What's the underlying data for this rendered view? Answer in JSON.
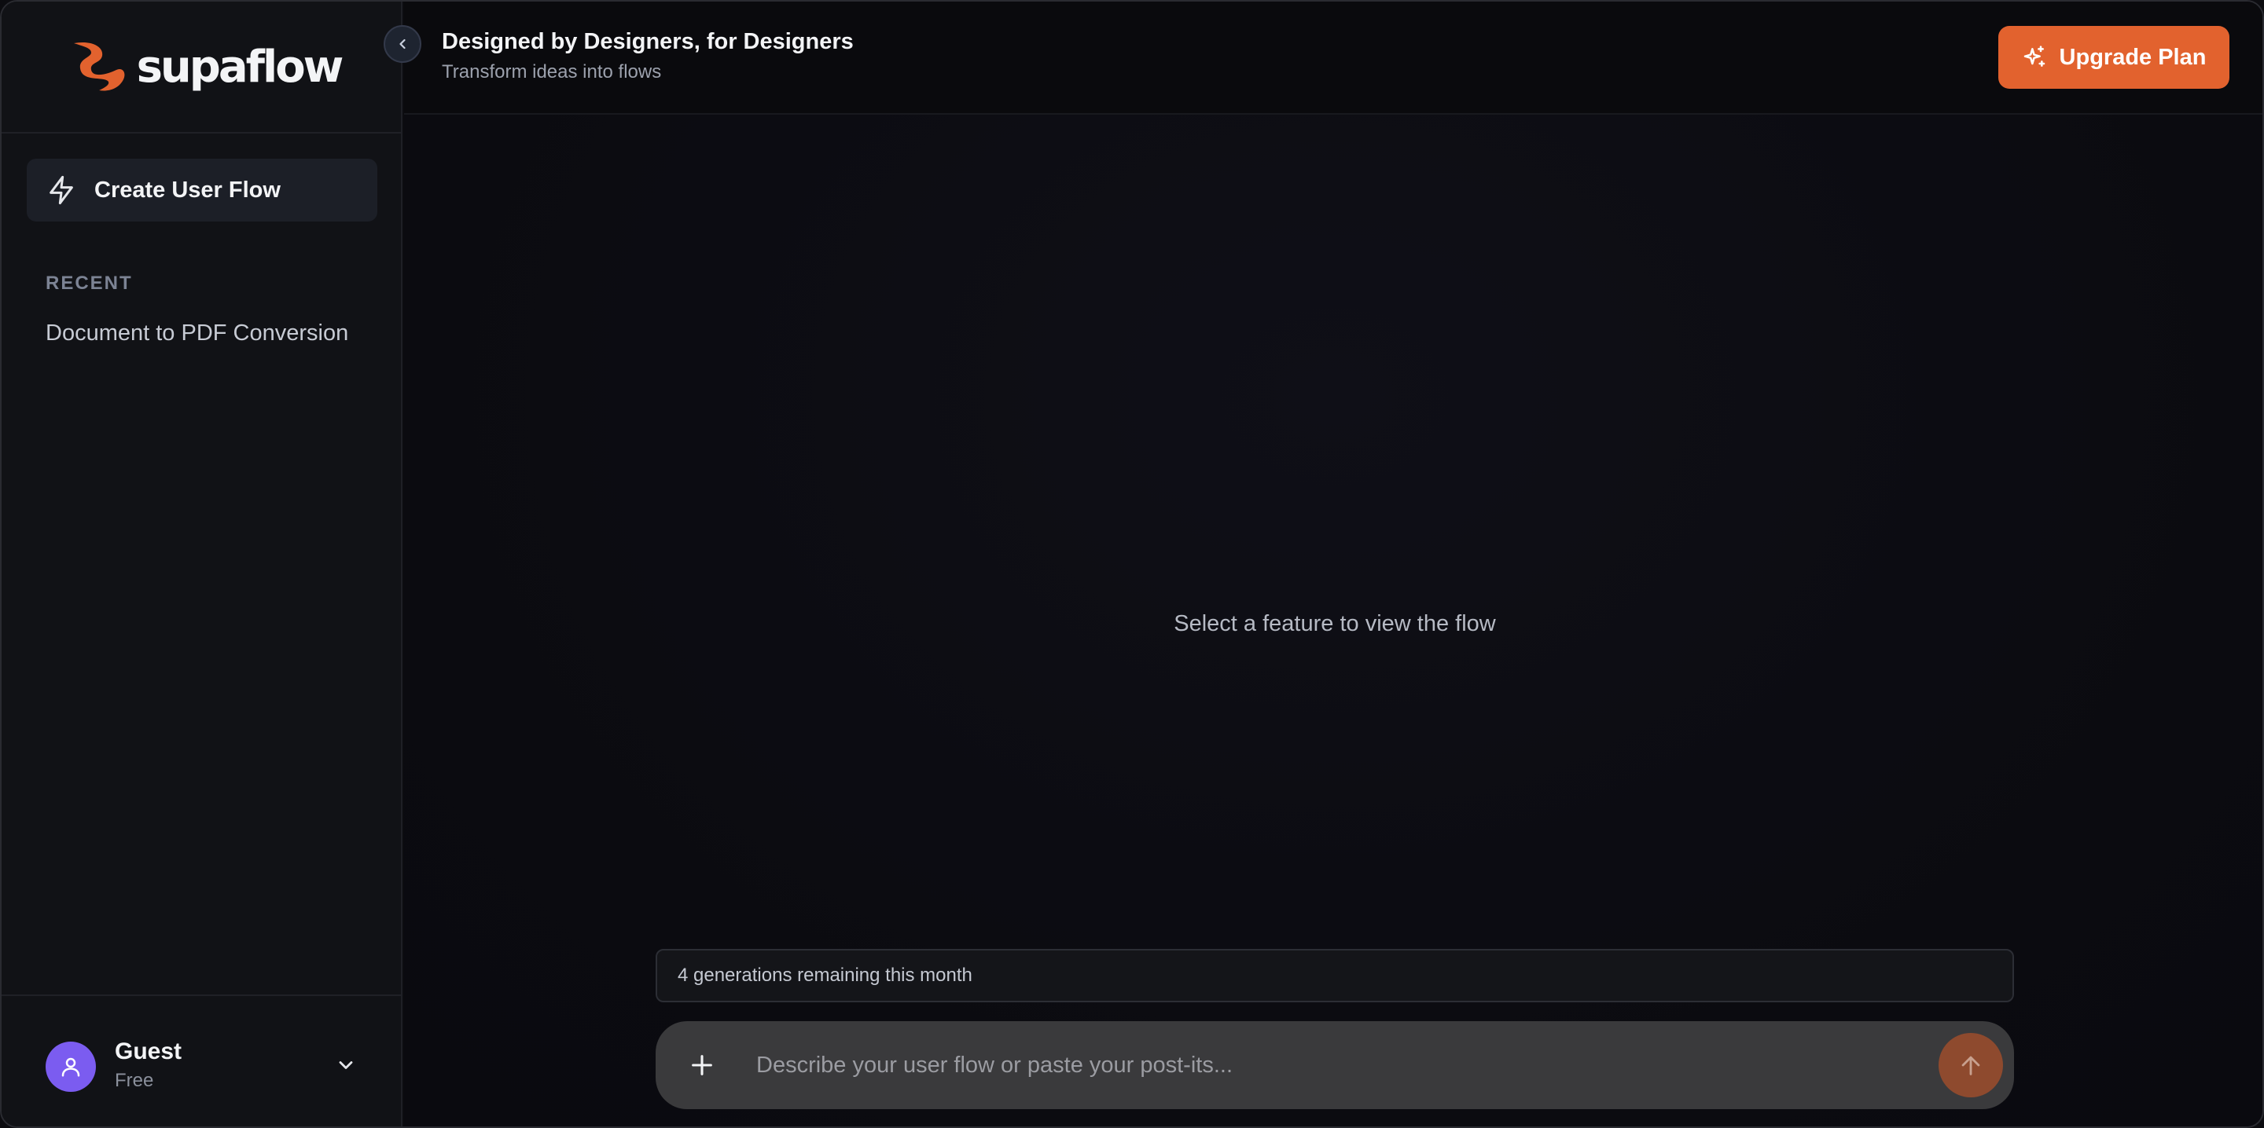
{
  "brand": {
    "name": "supaflow",
    "accent": "#e2622e"
  },
  "sidebar": {
    "create_button_label": "Create User Flow",
    "recent_heading": "RECENT",
    "recent_items": [
      {
        "label": "Document to PDF Conversion"
      }
    ],
    "user": {
      "name": "Guest",
      "plan": "Free"
    }
  },
  "header": {
    "title": "Designed by Designers, for Designers",
    "subtitle": "Transform ideas into flows",
    "upgrade_label": "Upgrade Plan"
  },
  "main": {
    "empty_state": "Select a feature to view the flow",
    "quota_text": "4 generations remaining this month",
    "composer_placeholder": "Describe your user flow or paste your post-its..."
  },
  "icons": {
    "logo": "supaflow-logo-icon",
    "create": "lightning-icon",
    "collapse": "chevron-left-icon",
    "upgrade": "sparkles-icon",
    "avatar": "user-icon",
    "user_menu": "chevron-down-icon",
    "attach": "plus-icon",
    "send": "arrow-up-icon"
  }
}
